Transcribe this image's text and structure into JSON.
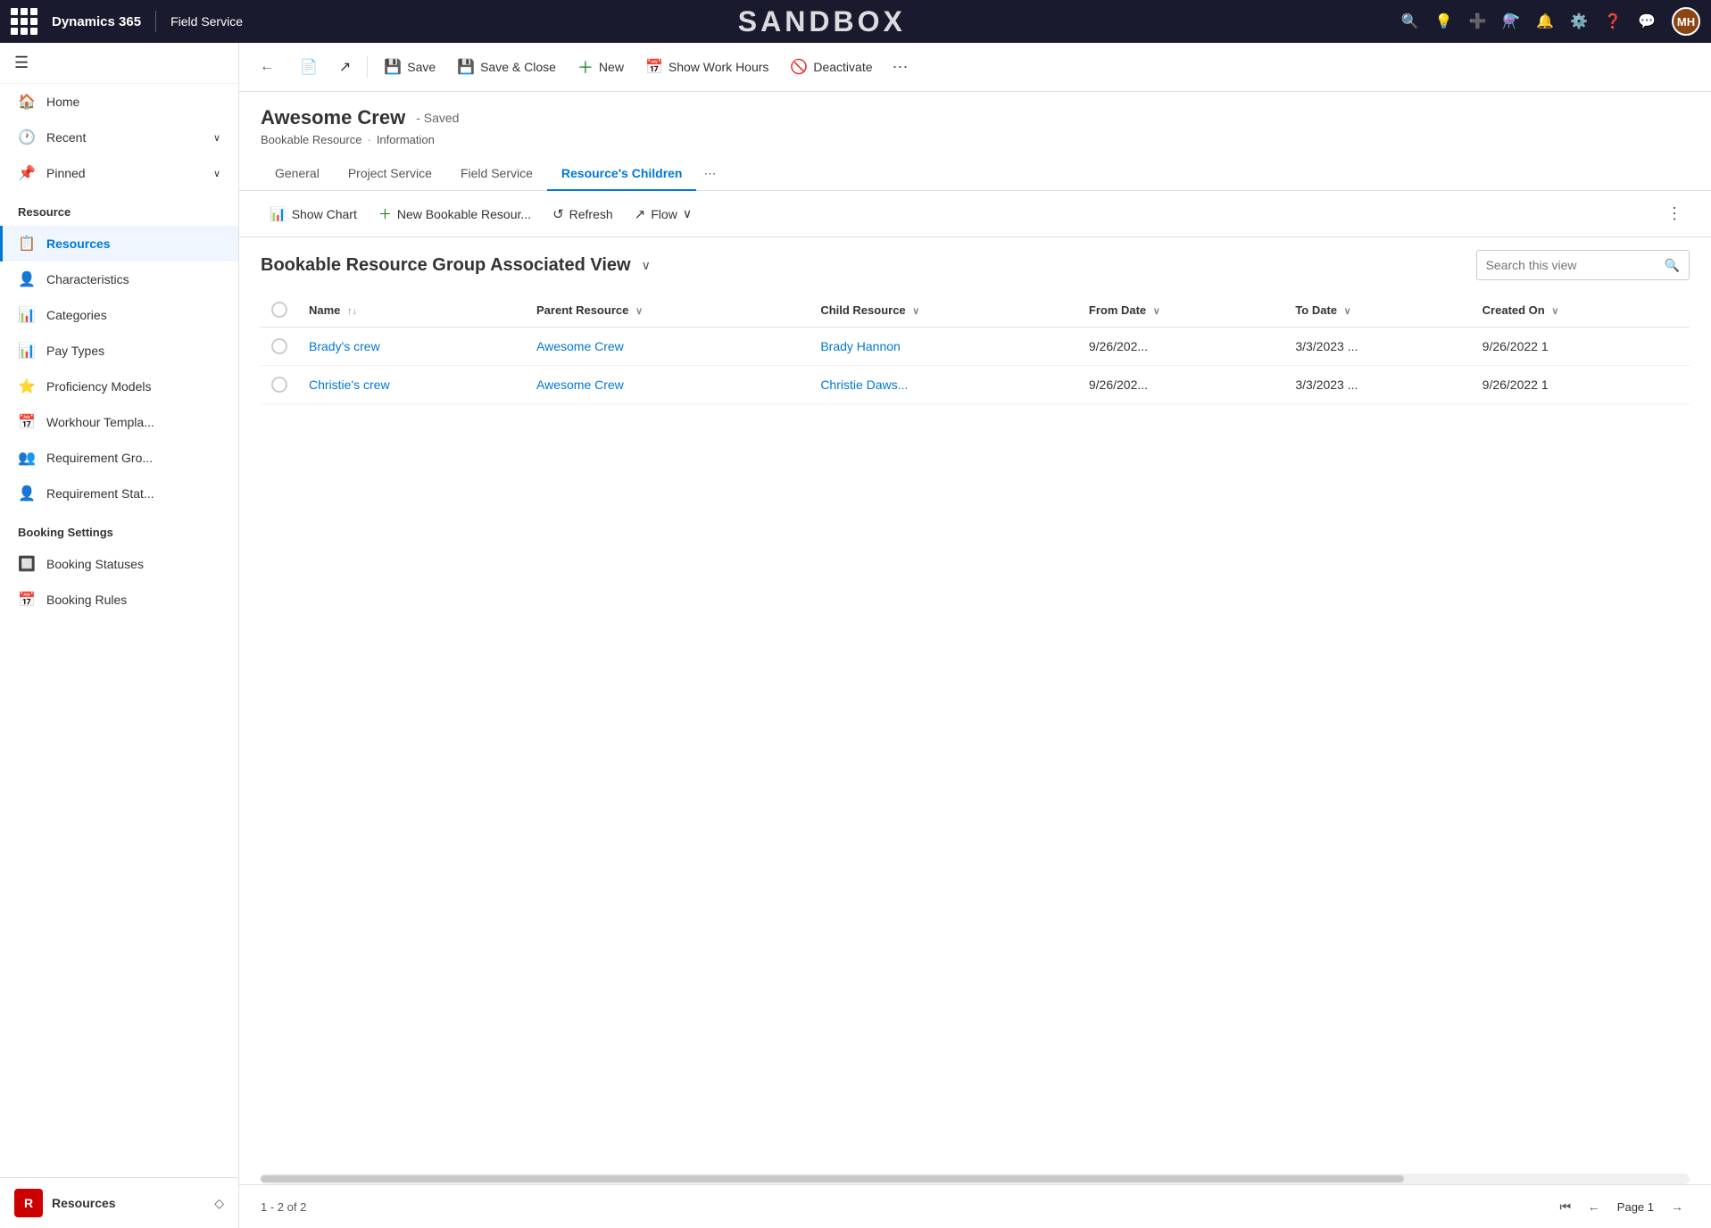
{
  "topnav": {
    "brand": "Dynamics 365",
    "module": "Field Service",
    "sandbox": "SANDBOX",
    "avatar_initials": "MH"
  },
  "sidebar": {
    "nav_items": [
      {
        "id": "home",
        "icon": "🏠",
        "label": "Home",
        "has_chevron": false
      },
      {
        "id": "recent",
        "icon": "🕐",
        "label": "Recent",
        "has_chevron": true
      },
      {
        "id": "pinned",
        "icon": "📌",
        "label": "Pinned",
        "has_chevron": true
      }
    ],
    "resource_section_title": "Resource",
    "resource_items": [
      {
        "id": "resources",
        "icon": "📋",
        "label": "Resources",
        "active": true
      },
      {
        "id": "characteristics",
        "icon": "👤",
        "label": "Characteristics",
        "active": false
      },
      {
        "id": "categories",
        "icon": "📊",
        "label": "Categories",
        "active": false
      },
      {
        "id": "pay-types",
        "icon": "📊",
        "label": "Pay Types",
        "active": false
      },
      {
        "id": "proficiency-models",
        "icon": "⭐",
        "label": "Proficiency Models",
        "active": false
      },
      {
        "id": "workhour-templates",
        "icon": "📅",
        "label": "Workhour Templa...",
        "active": false
      },
      {
        "id": "requirement-gro",
        "icon": "👥",
        "label": "Requirement Gro...",
        "active": false
      },
      {
        "id": "requirement-stat",
        "icon": "👤",
        "label": "Requirement Stat...",
        "active": false
      }
    ],
    "booking_section_title": "Booking Settings",
    "booking_items": [
      {
        "id": "booking-statuses",
        "icon": "🔲",
        "label": "Booking Statuses",
        "active": false
      },
      {
        "id": "booking-rules",
        "icon": "📅",
        "label": "Booking Rules",
        "active": false
      }
    ],
    "footer": {
      "avatar_letter": "R",
      "label": "Resources"
    }
  },
  "toolbar": {
    "back_label": "←",
    "forward_label": "→",
    "save_label": "Save",
    "save_close_label": "Save & Close",
    "new_label": "New",
    "show_work_hours_label": "Show Work Hours",
    "deactivate_label": "Deactivate"
  },
  "record": {
    "title": "Awesome Crew",
    "saved_status": "- Saved",
    "entity": "Bookable Resource",
    "view": "Information"
  },
  "tabs": [
    {
      "id": "general",
      "label": "General",
      "active": false
    },
    {
      "id": "project-service",
      "label": "Project Service",
      "active": false
    },
    {
      "id": "field-service",
      "label": "Field Service",
      "active": false
    },
    {
      "id": "resources-children",
      "label": "Resource's Children",
      "active": true
    }
  ],
  "sub_toolbar": {
    "show_chart_label": "Show Chart",
    "new_bookable_label": "New Bookable Resour...",
    "refresh_label": "Refresh",
    "flow_label": "Flow"
  },
  "view": {
    "title": "Bookable Resource Group Associated View",
    "search_placeholder": "Search this view"
  },
  "table": {
    "columns": [
      {
        "id": "name",
        "label": "Name",
        "sortable": true,
        "sort_dir": "asc"
      },
      {
        "id": "parent-resource",
        "label": "Parent Resource",
        "sortable": true
      },
      {
        "id": "child-resource",
        "label": "Child Resource",
        "sortable": true
      },
      {
        "id": "from-date",
        "label": "From Date",
        "sortable": true
      },
      {
        "id": "to-date",
        "label": "To Date",
        "sortable": true
      },
      {
        "id": "created-on",
        "label": "Created On",
        "sortable": true
      }
    ],
    "rows": [
      {
        "name": "Brady's crew",
        "parent_resource": "Awesome Crew",
        "child_resource": "Brady Hannon",
        "from_date": "9/26/202...",
        "to_date": "3/3/2023 ...",
        "created_on": "9/26/2022 1"
      },
      {
        "name": "Christie's crew",
        "parent_resource": "Awesome Crew",
        "child_resource": "Christie Daws...",
        "from_date": "9/26/202...",
        "to_date": "3/3/2023 ...",
        "created_on": "9/26/2022 1"
      }
    ]
  },
  "pagination": {
    "label": "1 - 2 of 2",
    "page_label": "Page 1"
  }
}
